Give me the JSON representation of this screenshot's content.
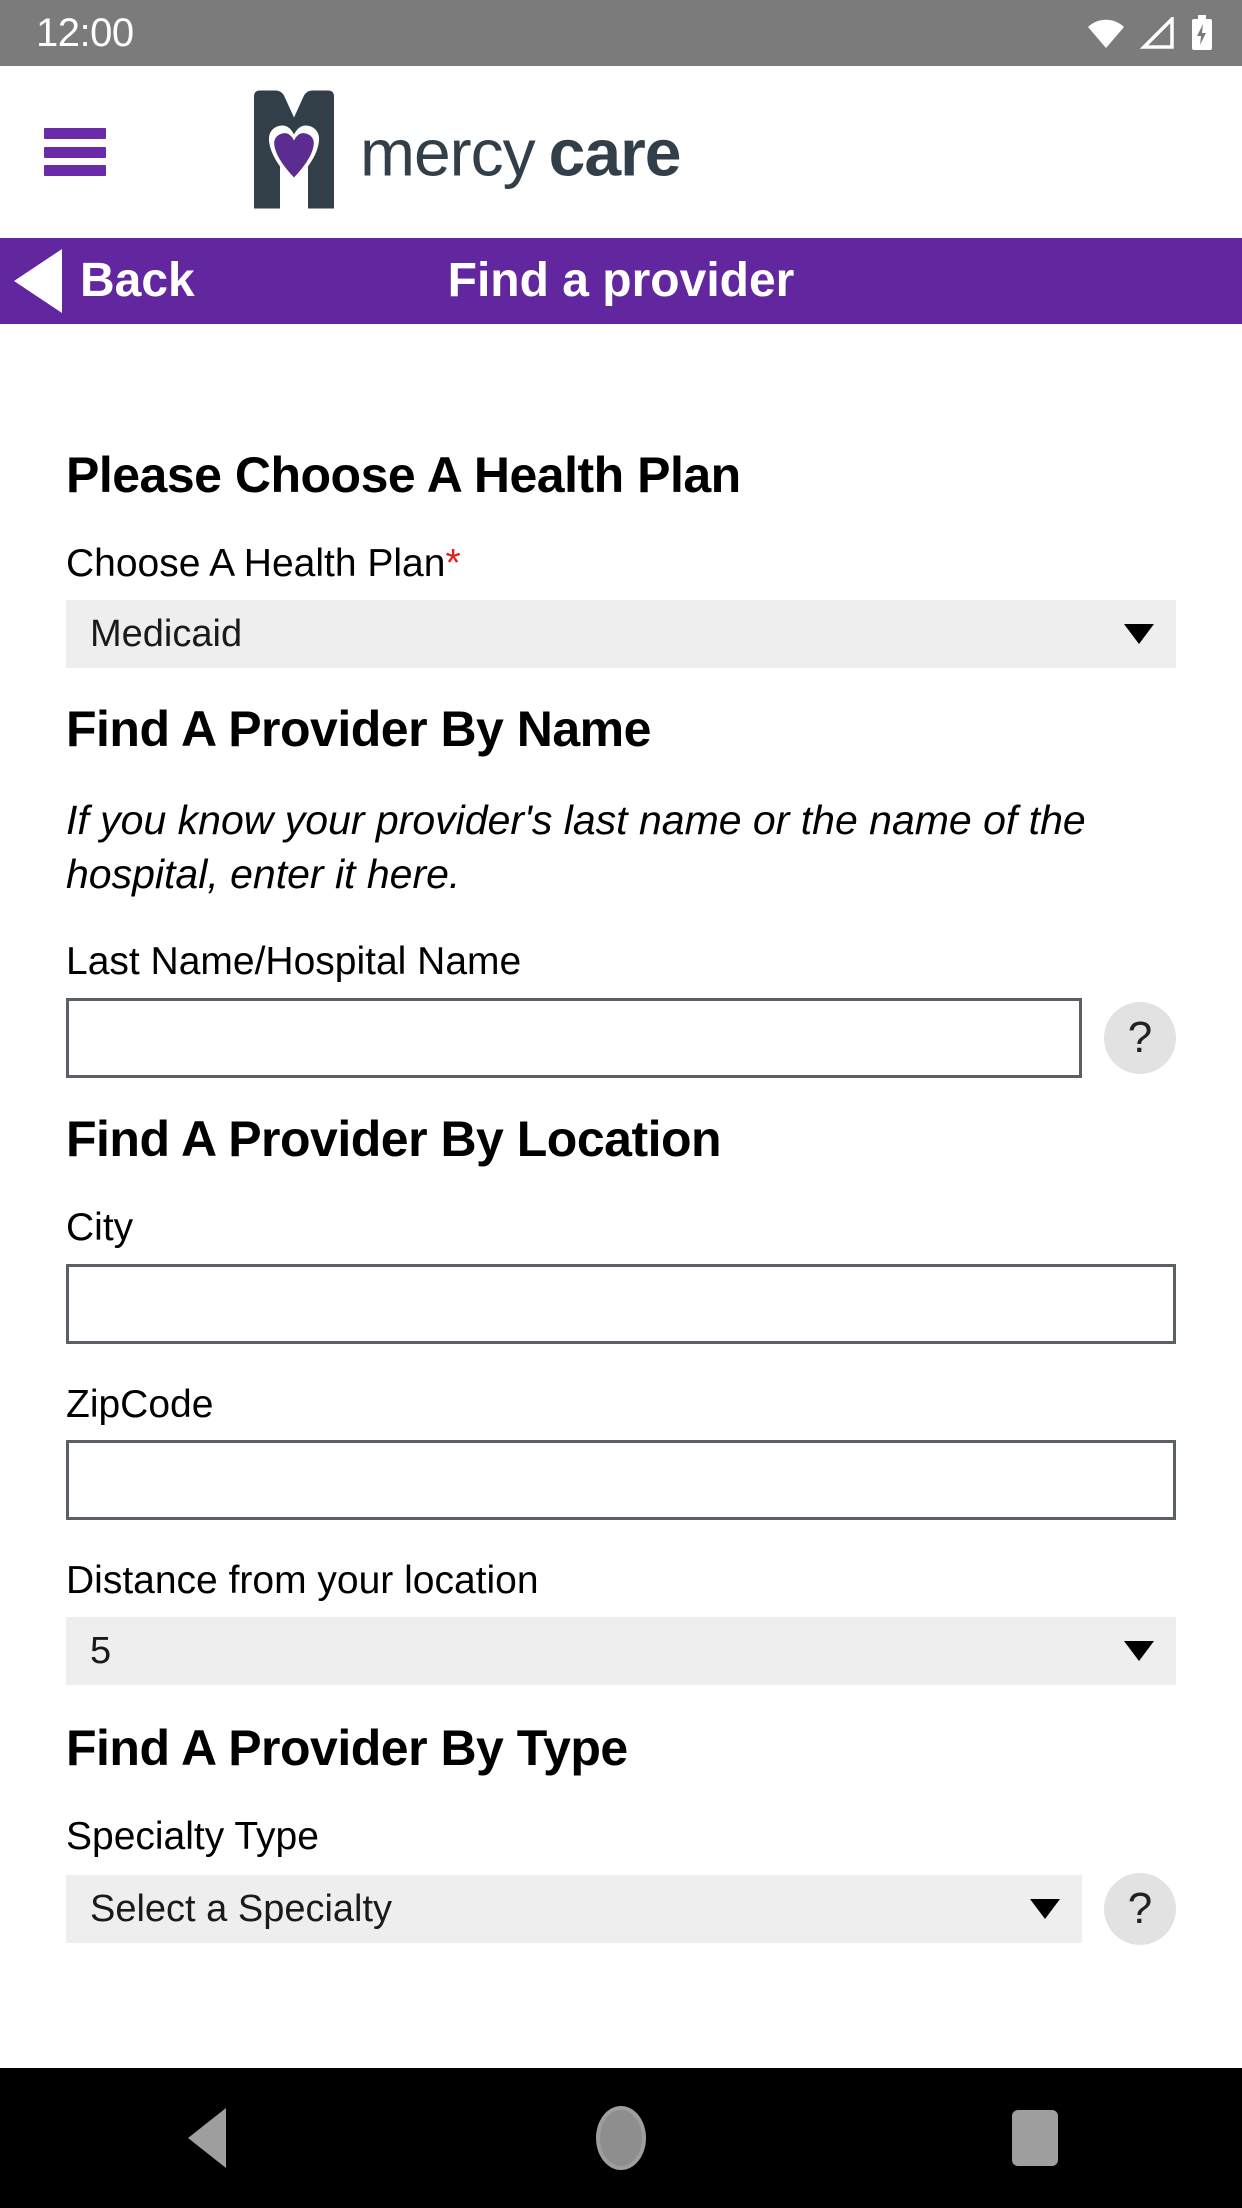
{
  "status_bar": {
    "clock": "12:00",
    "icons": [
      "wifi-icon",
      "cellular-signal-icon",
      "battery-charging-icon"
    ]
  },
  "brand_header": {
    "menu_icon": "hamburger-menu-icon",
    "logo_mark": "mercy-care-m-heart-logo",
    "logo_word_1": "mercy",
    "logo_word_2": "care",
    "logo_dark": "#333f48",
    "logo_purple": "#5b2d90"
  },
  "page_nav": {
    "back_label": "Back",
    "back_icon": "back-triangle-icon",
    "title": "Find a provider",
    "background": "#62269e"
  },
  "form": {
    "health_plan": {
      "heading": "Please Choose A Health Plan",
      "label": "Choose A Health Plan",
      "required_marker": "*",
      "required_color": "#e02020",
      "selected_value": "Medicaid",
      "caret_icon": "chevron-down-icon"
    },
    "by_name": {
      "heading": "Find A Provider By Name",
      "helper_text": "If you know your provider's last name or the name of the hospital, enter it here.",
      "label": "Last Name/Hospital Name",
      "value": "",
      "placeholder": "",
      "help_icon": "question-mark-help-icon",
      "help_label": "?"
    },
    "by_location": {
      "heading": "Find A Provider By Location",
      "city_label": "City",
      "city_value": "",
      "city_placeholder": "",
      "zip_label": "ZipCode",
      "zip_value": "",
      "zip_placeholder": "",
      "distance_label": "Distance from your location",
      "distance_value": "5",
      "caret_icon": "chevron-down-icon"
    },
    "by_type": {
      "heading": "Find A Provider By Type",
      "label": "Specialty Type",
      "selected_value": "Select a Specialty",
      "caret_icon": "chevron-down-icon",
      "help_icon": "question-mark-help-icon",
      "help_label": "?"
    }
  },
  "android_nav": {
    "back_icon": "android-back-icon",
    "home_icon": "android-home-icon",
    "recents_icon": "android-recents-icon"
  }
}
